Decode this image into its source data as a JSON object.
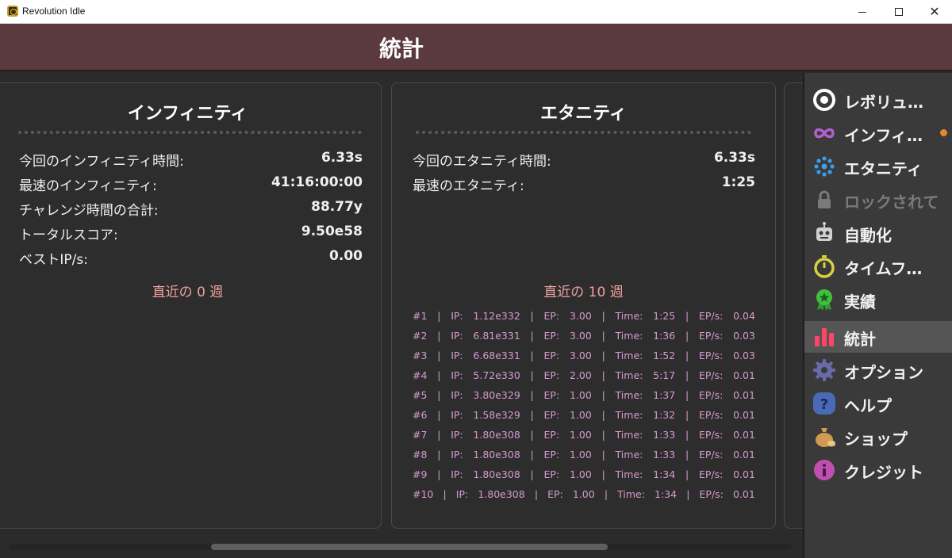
{
  "window": {
    "title": "Revolution Idle",
    "minimize_glyph": "",
    "close_glyph": "✕"
  },
  "header": {
    "title": "統計"
  },
  "infinity": {
    "title": "インフィニティ",
    "stats": [
      {
        "label": "今回のインフィニティ時間:",
        "value": "6.33s"
      },
      {
        "label": "最速のインフィニティ:",
        "value": "41:16:00:00"
      },
      {
        "label": "チャレンジ時間の合計:",
        "value": "88.77y"
      },
      {
        "label": "トータルスコア:",
        "value": "9.50e58"
      },
      {
        "label": "ベストIP/s:",
        "value": "0.00"
      }
    ],
    "recent_heading": "直近の 0 週"
  },
  "eternity": {
    "title": "エタニティ",
    "stats": [
      {
        "label": "今回のエタニティ時間:",
        "value": "6.33s"
      },
      {
        "label": "最速のエタニティ:",
        "value": "1:25"
      }
    ],
    "recent_heading": "直近の 10 週",
    "runs": [
      {
        "id": "#1",
        "ip": "IP:",
        "ip_val": "1.12e332",
        "ep": "EP:",
        "ep_val": "3.00",
        "time": "Time:",
        "time_val": "1:25",
        "eps": "EP/s:",
        "eps_val": "0.04"
      },
      {
        "id": "#2",
        "ip": "IP:",
        "ip_val": "6.81e331",
        "ep": "EP:",
        "ep_val": "3.00",
        "time": "Time:",
        "time_val": "1:36",
        "eps": "EP/s:",
        "eps_val": "0.03"
      },
      {
        "id": "#3",
        "ip": "IP:",
        "ip_val": "6.68e331",
        "ep": "EP:",
        "ep_val": "3.00",
        "time": "Time:",
        "time_val": "1:52",
        "eps": "EP/s:",
        "eps_val": "0.03"
      },
      {
        "id": "#4",
        "ip": "IP:",
        "ip_val": "5.72e330",
        "ep": "EP:",
        "ep_val": "2.00",
        "time": "Time:",
        "time_val": "5:17",
        "eps": "EP/s:",
        "eps_val": "0.01"
      },
      {
        "id": "#5",
        "ip": "IP:",
        "ip_val": "3.80e329",
        "ep": "EP:",
        "ep_val": "1.00",
        "time": "Time:",
        "time_val": "1:37",
        "eps": "EP/s:",
        "eps_val": "0.01"
      },
      {
        "id": "#6",
        "ip": "IP:",
        "ip_val": "1.58e329",
        "ep": "EP:",
        "ep_val": "1.00",
        "time": "Time:",
        "time_val": "1:32",
        "eps": "EP/s:",
        "eps_val": "0.01"
      },
      {
        "id": "#7",
        "ip": "IP:",
        "ip_val": "1.80e308",
        "ep": "EP:",
        "ep_val": "1.00",
        "time": "Time:",
        "time_val": "1:33",
        "eps": "EP/s:",
        "eps_val": "0.01"
      },
      {
        "id": "#8",
        "ip": "IP:",
        "ip_val": "1.80e308",
        "ep": "EP:",
        "ep_val": "1.00",
        "time": "Time:",
        "time_val": "1:33",
        "eps": "EP/s:",
        "eps_val": "0.01"
      },
      {
        "id": "#9",
        "ip": "IP:",
        "ip_val": "1.80e308",
        "ep": "EP:",
        "ep_val": "1.00",
        "time": "Time:",
        "time_val": "1:34",
        "eps": "EP/s:",
        "eps_val": "0.01"
      },
      {
        "id": "#10",
        "ip": "IP:",
        "ip_val": "1.80e308",
        "ep": "EP:",
        "ep_val": "1.00",
        "time": "Time:",
        "time_val": "1:34",
        "eps": "EP/s:",
        "eps_val": "0.01"
      }
    ],
    "separator": "|"
  },
  "sidebar": {
    "items": [
      {
        "label": "レボリュ…",
        "icon": "revolution-icon",
        "color": "#ffffff"
      },
      {
        "label": "インフィ…",
        "icon": "infinity-icon",
        "color": "#b060d0",
        "notify": true
      },
      {
        "label": "エタニティ",
        "icon": "eternity-icon",
        "color": "#3a9ee8"
      },
      {
        "label": "ロックされて",
        "icon": "lock-icon",
        "color": "#7a7a7a",
        "locked": true
      },
      {
        "label": "自動化",
        "icon": "robot-icon",
        "color": "#d0d0d0"
      },
      {
        "label": "タイムフ…",
        "icon": "stopwatch-icon",
        "color": "#d8d040"
      },
      {
        "label": "実績",
        "icon": "achievement-icon",
        "color": "#40c040"
      },
      {
        "label": "統計",
        "icon": "statistics-icon",
        "color": "#ff4466",
        "active": true
      },
      {
        "label": "オプション",
        "icon": "gear-icon",
        "color": "#6a6aa8"
      },
      {
        "label": "ヘルプ",
        "icon": "help-icon",
        "color": "#4a6ab8"
      },
      {
        "label": "ショップ",
        "icon": "money-bag-icon",
        "color": "#d09a50"
      },
      {
        "label": "クレジット",
        "icon": "info-icon",
        "color": "#c050b0"
      }
    ]
  }
}
